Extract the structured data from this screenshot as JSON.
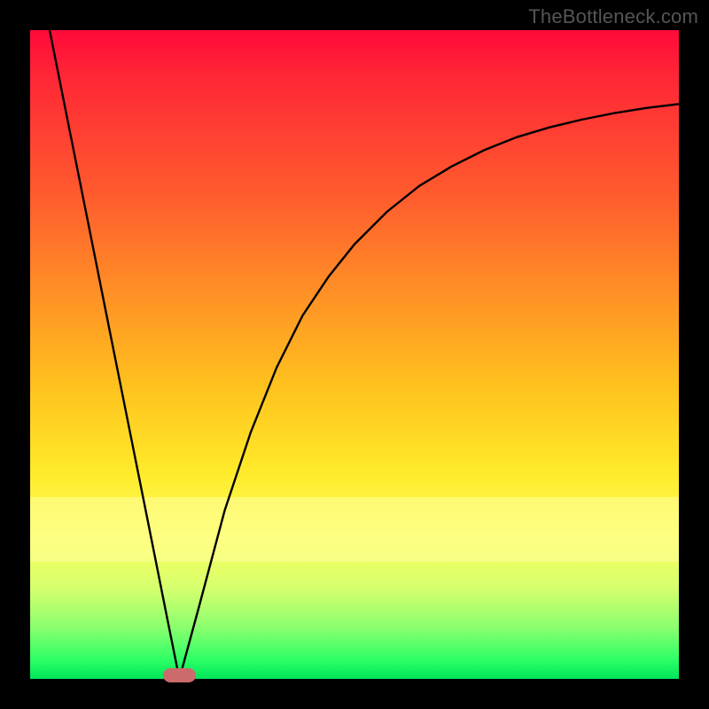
{
  "watermark": "TheBottleneck.com",
  "chart_data": {
    "type": "line",
    "title": "",
    "xlabel": "",
    "ylabel": "",
    "xlim": [
      0,
      100
    ],
    "ylim": [
      0,
      100
    ],
    "grid": false,
    "series": [
      {
        "name": "bottleneck-curve",
        "x": [
          3,
          6,
          9,
          12,
          15,
          18,
          21,
          23,
          26,
          30,
          34,
          38,
          42,
          46,
          50,
          55,
          60,
          65,
          70,
          75,
          80,
          85,
          90,
          95,
          100
        ],
        "y": [
          100,
          85,
          70,
          55,
          40,
          25,
          10,
          0,
          11,
          26,
          38,
          48,
          56,
          62,
          67,
          72,
          76,
          79,
          81.5,
          83.5,
          85,
          86.2,
          87.2,
          88,
          88.6
        ]
      }
    ],
    "annotations": [
      {
        "name": "optimal-marker",
        "x": 23,
        "y": 0.5,
        "w": 5,
        "h": 2.2
      }
    ],
    "background": {
      "type": "vertical-gradient",
      "stops": [
        {
          "pos": 0,
          "color": "#ff0a3a"
        },
        {
          "pos": 25,
          "color": "#ff5a2e"
        },
        {
          "pos": 55,
          "color": "#ffc21e"
        },
        {
          "pos": 78,
          "color": "#fcff5a"
        },
        {
          "pos": 92,
          "color": "#8cff6e"
        },
        {
          "pos": 100,
          "color": "#00e65a"
        }
      ]
    },
    "highlight_band": {
      "y_from": 72,
      "y_to": 82,
      "color": "rgba(255,255,160,0.55)"
    }
  }
}
